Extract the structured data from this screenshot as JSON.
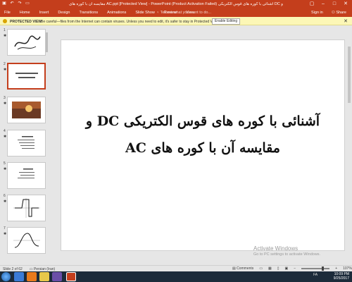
{
  "title_bar": {
    "title": "مقایسه آن با کوره های AC.ppt [Protected View] - PowerPoint (Product Activation Failed) آشنائی با کوره های قوس الکتریکی DC و"
  },
  "ribbon": {
    "tabs": [
      "File",
      "Home",
      "Insert",
      "Design",
      "Transitions",
      "Animations",
      "Slide Show",
      "Review",
      "View"
    ],
    "tell_me": "Tell me what you want to do...",
    "sign_in": "Sign in",
    "share": "Share"
  },
  "protected_view": {
    "label": "PROTECTED VIEW",
    "message": "Be careful—files from the Internet can contain viruses. Unless you need to edit, it's safer to stay in Protected View.",
    "button": "Enable Editing"
  },
  "thumbnails": [
    {
      "num": "1",
      "star": "✱"
    },
    {
      "num": "2",
      "star": "✱"
    },
    {
      "num": "3",
      "star": "✱"
    },
    {
      "num": "4",
      "star": "✱"
    },
    {
      "num": "5",
      "star": "✱"
    },
    {
      "num": "6",
      "star": "✱"
    },
    {
      "num": "7",
      "star": "✱"
    }
  ],
  "slide": {
    "line1": "آشنائی با کوره های قوس الکتریکی DC و",
    "line2": "مقایسه آن با کوره های AC"
  },
  "watermark": {
    "title": "Activate Windows",
    "subtitle": "Go to PC settings to activate Windows."
  },
  "status_bar": {
    "slide_info": "Slide 2 of 62",
    "language": "Persian (Iran)",
    "comments": "Comments",
    "zoom": "107%"
  },
  "taskbar": {
    "lang": "FA",
    "time": "10:09 PM",
    "date": "9/25/2017"
  },
  "colors": {
    "accent": "#c43e1c",
    "protected_bar": "#fcf7b6"
  }
}
